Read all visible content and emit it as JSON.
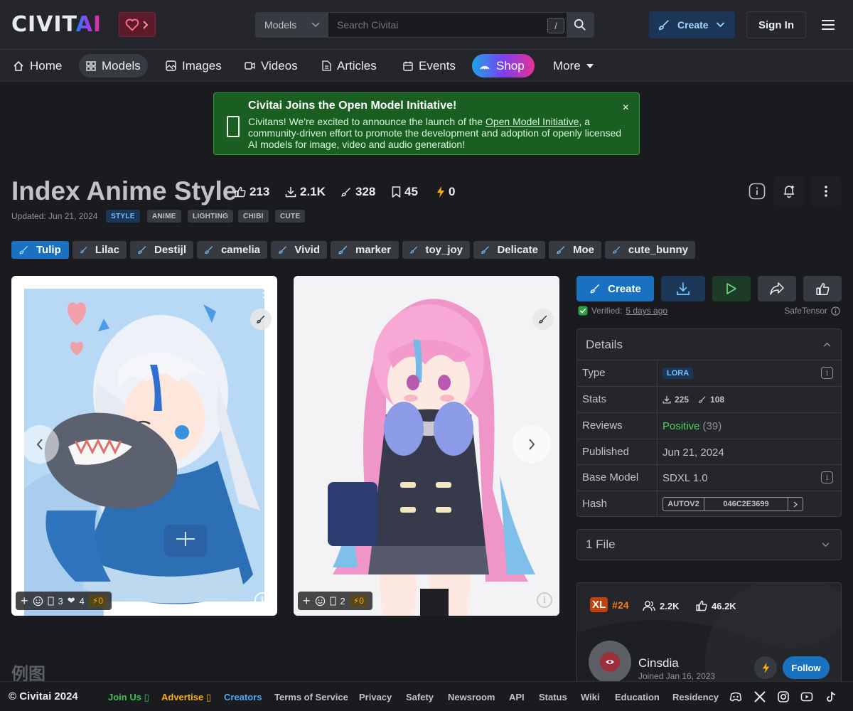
{
  "header": {
    "logo_main": "CIVIT",
    "logo_ai": "AI",
    "search_category": "Models",
    "search_placeholder": "Search Civitai",
    "search_shortcut": "/",
    "create_label": "Create",
    "signin_label": "Sign In"
  },
  "nav": {
    "items": [
      "Home",
      "Models",
      "Images",
      "Videos",
      "Articles",
      "Events",
      "Shop",
      "More"
    ]
  },
  "banner": {
    "title": "Civitai Joins the Open Model Initiative!",
    "body_before": "Civitans! We're excited to announce the launch of the ",
    "body_link": "Open Model Initiative",
    "body_after": ", a community-driven effort to promote the development and adoption of openly licensed AI models for image, video and audio generation!",
    "close": "×"
  },
  "model": {
    "title": "Index Anime Style",
    "stats": {
      "likes": "213",
      "downloads": "2.1K",
      "generations": "328",
      "collected": "45",
      "buzz": "0"
    },
    "updated": "Updated: Jun 21, 2024",
    "tags": [
      "STYLE",
      "ANIME",
      "LIGHTING",
      "CHIBI",
      "CUTE"
    ],
    "versions": [
      "Tulip",
      "Lilac",
      "Destijl",
      "camelia",
      "Vivid",
      "marker",
      "toy_joy",
      "Delicate",
      "Moe",
      "cute_bunny"
    ]
  },
  "gallery": {
    "cards": [
      {
        "comments": "3",
        "likes": "4",
        "buzz": "0"
      },
      {
        "comments": "2",
        "buzz": "0"
      }
    ]
  },
  "actions": {
    "create_label": "Create",
    "verified_label": "Verified:",
    "verified_time": "5 days ago",
    "safetensor": "SafeTensor"
  },
  "details": {
    "header": "Details",
    "type_label": "Type",
    "type_value": "LORA",
    "stats_label": "Stats",
    "stats_downloads": "225",
    "stats_generations": "108",
    "reviews_label": "Reviews",
    "reviews_value": "Positive",
    "reviews_count": "(39)",
    "published_label": "Published",
    "published_value": "Jun 21, 2024",
    "base_label": "Base Model",
    "base_value": "SDXL 1.0",
    "hash_label": "Hash",
    "hash_type": "AUTOV2",
    "hash_value": "046C2E3699"
  },
  "files": {
    "label": "1 File"
  },
  "creator": {
    "rank_badge": "XL",
    "rank": "#24",
    "followers": "2.2K",
    "likes": "46.2K",
    "name": "Cinsdia",
    "joined": "Joined Jan 16, 2023",
    "follow_label": "Follow"
  },
  "section_title": "例图",
  "footer": {
    "copyright": "© Civitai 2024",
    "links": [
      "Join Us",
      "Advertise",
      "Creators",
      "Terms of Service",
      "Privacy",
      "Safety",
      "Newsroom",
      "API",
      "Status",
      "Wiki",
      "Education",
      "Residency"
    ],
    "join_color": "#40c057",
    "advertise_color": "#fab005",
    "creators_color": "#4dabf7"
  }
}
